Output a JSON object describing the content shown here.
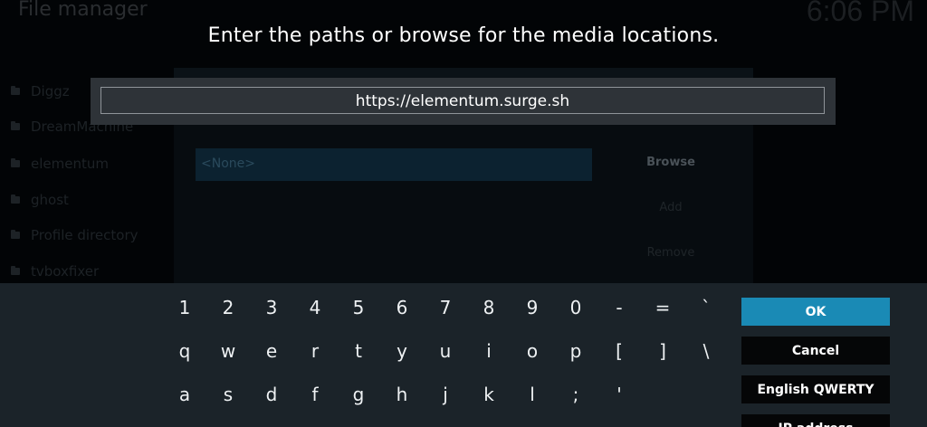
{
  "background": {
    "window_title": "File manager",
    "clock": "6:06 PM",
    "sources": [
      "Diggz",
      "DreamMachine",
      "elementum",
      "ghost",
      "Profile directory",
      "tvboxfixer"
    ],
    "dialog": {
      "path_value": "<None>",
      "buttons": [
        "Browse",
        "Add",
        "Remove"
      ]
    }
  },
  "prompt": {
    "heading": "Enter the paths or browse for the media locations.",
    "input_value": "https://elementum.surge.sh"
  },
  "keyboard": {
    "rows": [
      [
        "1",
        "2",
        "3",
        "4",
        "5",
        "6",
        "7",
        "8",
        "9",
        "0",
        "-",
        "=",
        "`"
      ],
      [
        "q",
        "w",
        "e",
        "r",
        "t",
        "y",
        "u",
        "i",
        "o",
        "p",
        "[",
        "]",
        "\\"
      ],
      [
        "a",
        "s",
        "d",
        "f",
        "g",
        "h",
        "j",
        "k",
        "l",
        ";",
        "'"
      ]
    ],
    "actions": {
      "ok": "OK",
      "cancel": "Cancel",
      "layout": "English QWERTY",
      "ip": "IP address"
    },
    "focus_color": "#1a8ab5"
  }
}
